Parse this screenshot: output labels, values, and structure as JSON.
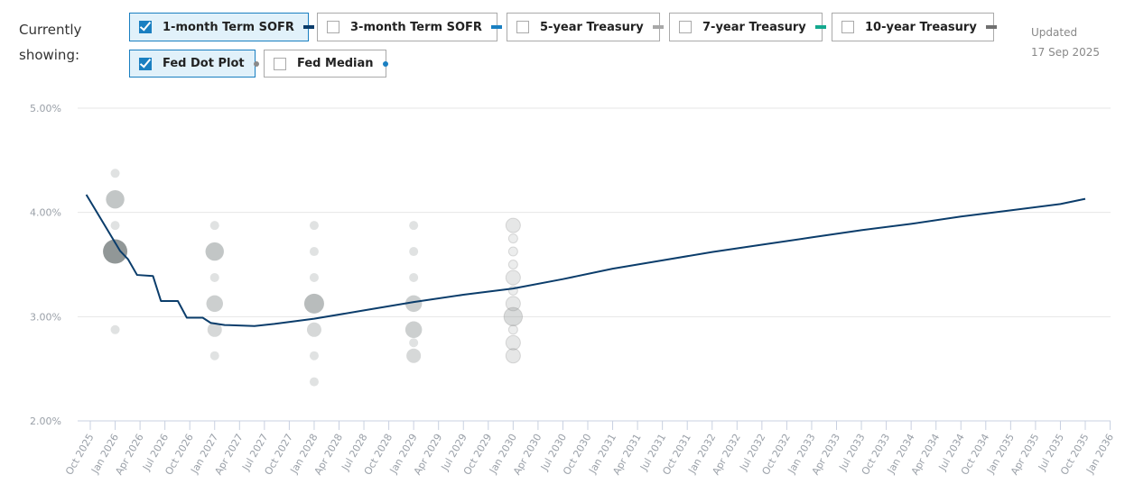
{
  "header": {
    "currently": "Currently",
    "showing": "showing:",
    "updated_label": "Updated",
    "updated_date": "17 Sep 2025"
  },
  "toggles": [
    {
      "label": "1-month Term SOFR",
      "checked": true,
      "color": "#0b3d6b",
      "marker": "line"
    },
    {
      "label": "3-month Term SOFR",
      "checked": false,
      "color": "#1a7fc1",
      "marker": "line"
    },
    {
      "label": "5-year Treasury",
      "checked": false,
      "color": "#a8a8a8",
      "marker": "line"
    },
    {
      "label": "7-year Treasury",
      "checked": false,
      "color": "#14a88e",
      "marker": "line"
    },
    {
      "label": "10-year Treasury",
      "checked": false,
      "color": "#707070",
      "marker": "line"
    },
    {
      "label": "Fed Dot Plot",
      "checked": true,
      "color": "#8a8a8a",
      "marker": "dot"
    },
    {
      "label": "Fed Median",
      "checked": false,
      "color": "#1a7fc1",
      "marker": "dot"
    }
  ],
  "chart_data": {
    "type": "line",
    "ylim": [
      2,
      5
    ],
    "yticks": [
      {
        "v": 5,
        "label": "5.00%"
      },
      {
        "v": 4,
        "label": "4.00%"
      },
      {
        "v": 3,
        "label": "3.00%"
      },
      {
        "v": 2,
        "label": "2.00%"
      }
    ],
    "x_start": 2025.75,
    "x_step": 0.25,
    "xticks": [
      "Oct 2025",
      "Jan 2026",
      "Apr 2026",
      "Jul 2026",
      "Oct 2026",
      "Jan 2027",
      "Apr 2027",
      "Jul 2027",
      "Oct 2027",
      "Jan 2028",
      "Apr 2028",
      "Jul 2028",
      "Oct 2028",
      "Jan 2029",
      "Apr 2029",
      "Jul 2029",
      "Oct 2029",
      "Jan 2030",
      "Apr 2030",
      "Jul 2030",
      "Oct 2030",
      "Jan 2031",
      "Apr 2031",
      "Jul 2031",
      "Oct 2031",
      "Jan 2032",
      "Apr 2032",
      "Jul 2032",
      "Oct 2032",
      "Jan 2033",
      "Apr 2033",
      "Jul 2033",
      "Oct 2033",
      "Jan 2034",
      "Apr 2034",
      "Jul 2034",
      "Oct 2034",
      "Jan 2035",
      "Apr 2035",
      "Jul 2035",
      "Oct 2035",
      "Jan 2036"
    ],
    "series": [
      {
        "name": "1-month Term SOFR",
        "color": "#0b3d6b",
        "points": [
          [
            2025.71,
            4.17
          ],
          [
            2026.05,
            3.63
          ],
          [
            2026.13,
            3.55
          ],
          [
            2026.22,
            3.4
          ],
          [
            2026.38,
            3.39
          ],
          [
            2026.46,
            3.15
          ],
          [
            2026.63,
            3.15
          ],
          [
            2026.72,
            2.99
          ],
          [
            2026.88,
            2.99
          ],
          [
            2026.96,
            2.94
          ],
          [
            2027.1,
            2.92
          ],
          [
            2027.4,
            2.91
          ],
          [
            2027.6,
            2.93
          ],
          [
            2028.0,
            2.98
          ],
          [
            2028.5,
            3.06
          ],
          [
            2029.0,
            3.14
          ],
          [
            2029.5,
            3.21
          ],
          [
            2030.0,
            3.27
          ],
          [
            2030.5,
            3.36
          ],
          [
            2031.0,
            3.46
          ],
          [
            2031.5,
            3.54
          ],
          [
            2032.0,
            3.62
          ],
          [
            2032.5,
            3.69
          ],
          [
            2033.0,
            3.76
          ],
          [
            2033.5,
            3.83
          ],
          [
            2034.0,
            3.89
          ],
          [
            2034.5,
            3.96
          ],
          [
            2035.0,
            4.02
          ],
          [
            2035.5,
            4.08
          ],
          [
            2035.75,
            4.13
          ]
        ]
      }
    ],
    "dot_plot": {
      "name": "Fed Dot Plot",
      "groups": [
        {
          "x": 2026.0,
          "long_run": false,
          "dots": [
            [
              4.375,
              1
            ],
            [
              4.125,
              4
            ],
            [
              3.875,
              1
            ],
            [
              3.625,
              9
            ],
            [
              2.875,
              1
            ]
          ]
        },
        {
          "x": 2027.0,
          "long_run": false,
          "dots": [
            [
              3.875,
              1
            ],
            [
              3.625,
              4
            ],
            [
              3.375,
              1
            ],
            [
              3.125,
              3
            ],
            [
              2.875,
              2
            ],
            [
              2.625,
              1
            ]
          ]
        },
        {
          "x": 2028.0,
          "long_run": false,
          "dots": [
            [
              3.875,
              1
            ],
            [
              3.625,
              1
            ],
            [
              3.375,
              1
            ],
            [
              3.125,
              5
            ],
            [
              2.875,
              2
            ],
            [
              2.625,
              1
            ],
            [
              2.375,
              1
            ]
          ]
        },
        {
          "x": 2029.0,
          "long_run": false,
          "dots": [
            [
              3.875,
              1
            ],
            [
              3.625,
              1
            ],
            [
              3.375,
              1
            ],
            [
              3.125,
              3
            ],
            [
              2.875,
              3
            ],
            [
              2.75,
              1
            ],
            [
              2.625,
              2
            ]
          ]
        },
        {
          "x": 2030.0,
          "long_run": true,
          "dots": [
            [
              3.875,
              2
            ],
            [
              3.75,
              1
            ],
            [
              3.625,
              1
            ],
            [
              3.5,
              1
            ],
            [
              3.375,
              2
            ],
            [
              3.25,
              1
            ],
            [
              3.125,
              2
            ],
            [
              3.0,
              4
            ],
            [
              2.875,
              1
            ],
            [
              2.75,
              2
            ],
            [
              2.625,
              2
            ]
          ]
        }
      ]
    }
  }
}
